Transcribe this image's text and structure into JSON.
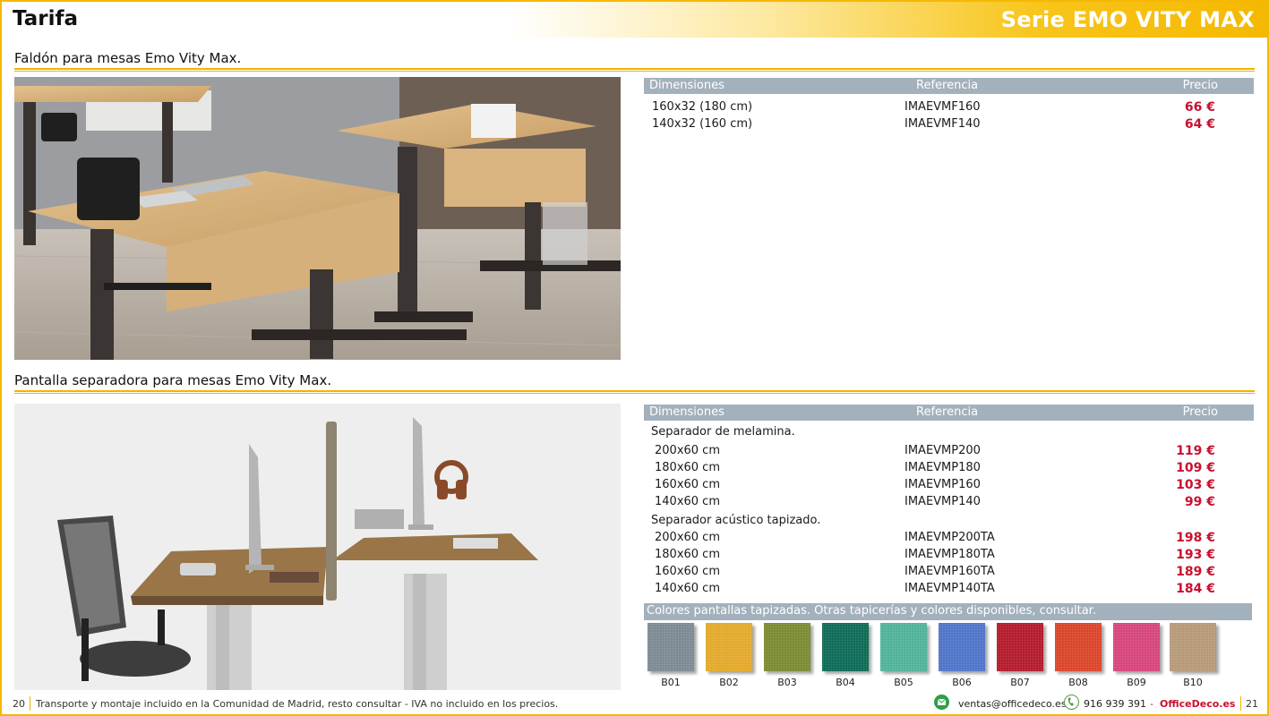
{
  "header": {
    "title": "Tarifa",
    "series": "Serie EMO VITY MAX"
  },
  "section1": {
    "title": "Faldón para mesas Emo Vity Max.",
    "table": {
      "headers": {
        "dim": "Dimensiones",
        "ref": "Referencia",
        "price": "Precio"
      },
      "rows": [
        {
          "dim": "160x32 (180 cm)",
          "ref": "IMAEVMF160",
          "price": "66 €"
        },
        {
          "dim": "140x32 (160 cm)",
          "ref": "IMAEVMF140",
          "price": "64 €"
        }
      ]
    }
  },
  "section2": {
    "title": "Pantalla separadora para mesas Emo Vity Max.",
    "table": {
      "headers": {
        "dim": "Dimensiones",
        "ref": "Referencia",
        "price": "Precio"
      },
      "group1": {
        "label": "Separador de melamina.",
        "rows": [
          {
            "dim": "200x60 cm",
            "ref": "IMAEVMP200",
            "price": "119 €"
          },
          {
            "dim": "180x60 cm",
            "ref": "IMAEVMP180",
            "price": "109 €"
          },
          {
            "dim": "160x60 cm",
            "ref": "IMAEVMP160",
            "price": "103 €"
          },
          {
            "dim": "140x60 cm",
            "ref": "IMAEVMP140",
            "price": "99 €"
          }
        ]
      },
      "group2": {
        "label": "Separador acústico tapizado.",
        "rows": [
          {
            "dim": "200x60 cm",
            "ref": "IMAEVMP200TA",
            "price": "198 €"
          },
          {
            "dim": "180x60 cm",
            "ref": "IMAEVMP180TA",
            "price": "193 €"
          },
          {
            "dim": "160x60 cm",
            "ref": "IMAEVMP160TA",
            "price": "189 €"
          },
          {
            "dim": "140x60 cm",
            "ref": "IMAEVMP140TA",
            "price": "184 €"
          }
        ]
      }
    },
    "colors_title": "Colores pantallas tapizadas. Otras tapicerías y colores disponibles, consultar.",
    "colors": [
      {
        "code": "B01",
        "hex": "#7d8a93"
      },
      {
        "code": "B02",
        "hex": "#e3a92b"
      },
      {
        "code": "B03",
        "hex": "#7a8b32"
      },
      {
        "code": "B04",
        "hex": "#0e6b55"
      },
      {
        "code": "B05",
        "hex": "#4fb39a"
      },
      {
        "code": "B06",
        "hex": "#4f74c9"
      },
      {
        "code": "B07",
        "hex": "#b31b2c"
      },
      {
        "code": "B08",
        "hex": "#d9452a"
      },
      {
        "code": "B09",
        "hex": "#d6457c"
      },
      {
        "code": "B10",
        "hex": "#b69a78"
      }
    ]
  },
  "footer": {
    "page_left": "20",
    "note": "Transporte y montaje incluido en la Comunidad de Madrid, resto consultar - IVA no incluido en los precios.",
    "email": "ventas@officedeco.es",
    "phone": "916 939 391",
    "dash": "-",
    "brand": "OfficeDeco.es",
    "page_right": "21"
  }
}
